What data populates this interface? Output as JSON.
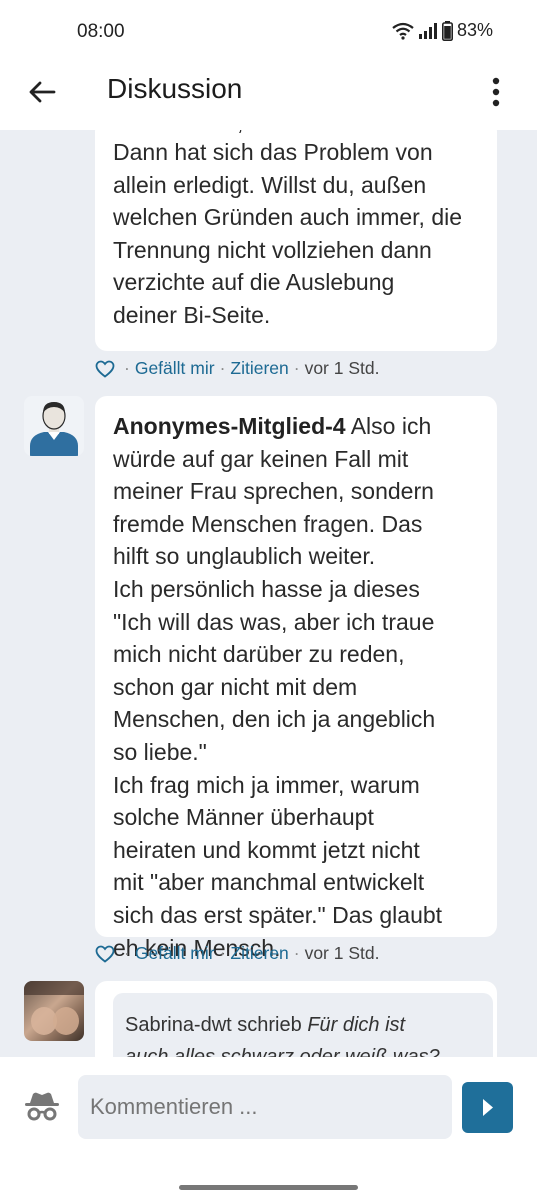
{
  "status_bar": {
    "time": "08:00",
    "battery": "83%"
  },
  "app_bar": {
    "title": "Diskussion"
  },
  "comments": [
    {
      "partial_top_line": "entscheiden, dass solltest du.",
      "text": "Dann hat sich das Problem von\nallein erledigt. Willst du, außen\nwelchen Gründen auch immer, die\nTrennung nicht vollziehen dann\nverzichte auf die Auslebung\ndeiner Bi-Seite.",
      "like_label": "Gefällt mir",
      "quote_label": "Zitieren",
      "time": "vor 1 Std."
    },
    {
      "author": "Anonymes-Mitglied-4",
      "text": " Also ich\nwürde auf gar keinen Fall mit\nmeiner Frau sprechen, sondern\nfremde Menschen fragen. Das\nhilft so unglaublich weiter.\nIch persönlich hasse ja dieses\n\"Ich will das was, aber ich traue\nmich nicht darüber zu reden,\nschon gar nicht mit dem\nMenschen, den ich ja angeblich\nso liebe.\"\nIch frag mich ja immer, warum\nsolche Männer überhaupt\nheiraten und kommt jetzt nicht\nmit \"aber manchmal entwickelt\nsich das erst später.\" Das glaubt\neh kein Mensch.",
      "like_label": "Gefällt mir",
      "quote_label": "Zitieren",
      "time": "vor 1 Std."
    },
    {
      "quote_author": "Sabrina-dwt schrieb",
      "quote_text": "Für dich ist\nauch alles schwarz oder weiß was?"
    }
  ],
  "composer": {
    "placeholder": "Kommentieren ..."
  },
  "colors": {
    "accent": "#1f6f9a",
    "link": "#1d6a93",
    "background": "#ebeef3"
  }
}
